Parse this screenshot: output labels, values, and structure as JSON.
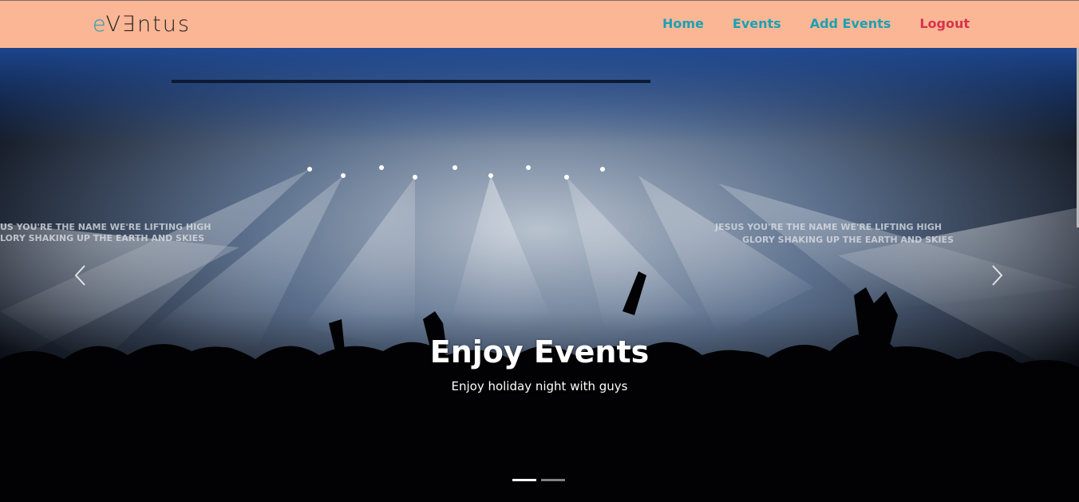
{
  "brand": {
    "first_letter": "e",
    "rest": "Vꓱntus"
  },
  "nav": {
    "items": [
      {
        "label": "Home"
      },
      {
        "label": "Events"
      },
      {
        "label": "Add Events"
      },
      {
        "label": "Logout"
      }
    ]
  },
  "hero": {
    "title": "Enjoy Events",
    "subtitle": "Enjoy holiday night with guys",
    "screen_text_left_1": "US YOU'RE THE NAME WE'RE LIFTING HIGH",
    "screen_text_left_2": "LORY SHAKING UP THE EARTH AND SKIES",
    "screen_text_right_1": "JESUS YOU'RE THE NAME WE'RE LIFTING HIGH",
    "screen_text_right_2": "GLORY SHAKING UP THE EARTH AND SKIES",
    "slide_count": 2,
    "active_slide": 1
  },
  "icons": {
    "prev": "chevron-left-icon",
    "next": "chevron-right-icon"
  },
  "colors": {
    "navbar_bg": "#fbb695",
    "nav_link": "#1aa1b5",
    "logout_link": "#d8334a"
  }
}
